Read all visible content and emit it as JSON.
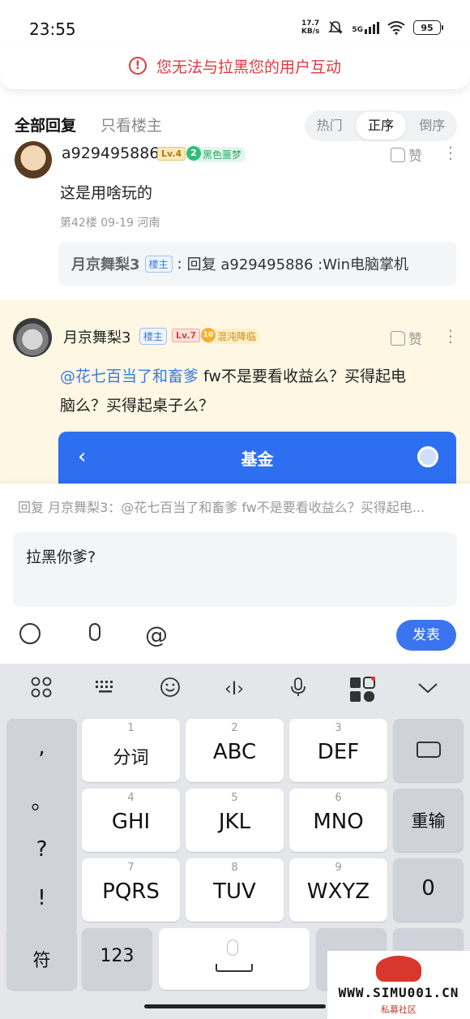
{
  "status": {
    "time": "23:55",
    "speed_top": "17.7",
    "speed_bottom": "KB/s",
    "network": "5G",
    "battery": "95"
  },
  "warning": {
    "icon": "exclamation-circle-icon",
    "text": "您无法与拉黑您的用户互动"
  },
  "tabs": {
    "all": "全部回复",
    "op_only": "只看楼主",
    "sort": [
      "热门",
      "正序",
      "倒序"
    ],
    "sort_selected": "正序"
  },
  "comment1": {
    "user": "a929495886",
    "level": "Lv.4",
    "badge_num": "2",
    "badge_text": "黑色噩梦",
    "like": "赞",
    "text": "这是用啥玩的",
    "meta": "第42楼  09-19  河南",
    "reply": {
      "name": "月京舞梨3",
      "op_tag": "楼主",
      "colon": ":",
      "text": "回复 a929495886 :Win电脑掌机"
    }
  },
  "comment2": {
    "user": "月京舞梨3",
    "op_tag": "楼主",
    "level": "Lv.7",
    "badge_num": "10",
    "badge_text": "混沌降临",
    "like": "赞",
    "mention": "@花七百当了和畜爹",
    "text_line1": " fw不是要看收益么？买得起电",
    "text_line2": "脑么？买得起桌子么？",
    "fund_title": "基金"
  },
  "composer": {
    "reply_to": "回复 月京舞梨3：@花七百当了和畜爹  fw不是要看收益么？买得起电...",
    "input_value": "拉黑你爹?",
    "send": "发表"
  },
  "keyboard": {
    "punct": [
      ",",
      "。",
      "?",
      "!"
    ],
    "row1": [
      {
        "n": "1",
        "l": "分词"
      },
      {
        "n": "2",
        "l": "ABC"
      },
      {
        "n": "3",
        "l": "DEF"
      }
    ],
    "row2": [
      {
        "n": "4",
        "l": "GHI"
      },
      {
        "n": "5",
        "l": "JKL"
      },
      {
        "n": "6",
        "l": "MNO"
      }
    ],
    "row3": [
      {
        "n": "7",
        "l": "PQRS"
      },
      {
        "n": "8",
        "l": "TUV"
      },
      {
        "n": "9",
        "l": "WXYZ"
      }
    ],
    "reenter": "重输",
    "zero": "0",
    "symbols": "符",
    "numbers": "123"
  },
  "watermark": {
    "url": "WWW.SIMU001.CN",
    "sub": "私募社区"
  },
  "colors": {
    "warning_red": "#e0393e",
    "accent_blue": "#3b74ee",
    "highlight_bg": "#fdf7e3"
  }
}
